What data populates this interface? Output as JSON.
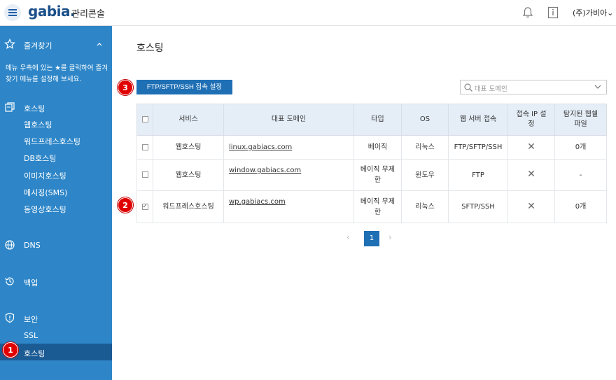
{
  "header": {
    "logo": "gabia.",
    "console_title": "관리콘솔",
    "user_name": "(주)가비아",
    "user_chevron": "⌄",
    "icons": [
      "menu-icon",
      "bell-icon",
      "info-icon",
      "chevron-down-icon"
    ]
  },
  "sidebar": {
    "favorites_label": "즐겨찾기",
    "favorites_note": "메뉴 우측에 있는 ★를 클릭하여 즐겨찾기 메뉴를 설정해 보세요.",
    "hosting_label": "호스팅",
    "hosting_items": [
      "웹호스팅",
      "워드프레스호스팅",
      "DB호스팅",
      "이미지호스팅",
      "메시징(SMS)",
      "동영상호스팅"
    ],
    "dns_label": "DNS",
    "backup_label": "백업",
    "security_label": "보안",
    "security_items": [
      "SSL",
      "호스팅"
    ],
    "icons": [
      "star-icon",
      "chevron-up-icon",
      "hosting-icon",
      "globe-icon",
      "backup-icon",
      "shield-icon"
    ]
  },
  "badges": [
    "1",
    "2",
    "3"
  ],
  "main": {
    "title": "호스팅",
    "ftp_button": "FTP/SFTP/SSH 접속 설정",
    "search_placeholder": "대표 도메인",
    "columns": [
      "서비스",
      "대표 도메인",
      "타입",
      "OS",
      "웹 서버 접속",
      "접속 IP 설정",
      "탐지된 웹쉘 파일"
    ],
    "rows": [
      {
        "service": "웹호스팅",
        "domain": "linux.gabiacs.com",
        "type": "베이직",
        "os": "리눅스",
        "access": "FTP/SFTP/SSH",
        "ip": "✕",
        "webshell": "0개",
        "checked": false
      },
      {
        "service": "웹호스팅",
        "domain": "window.gabiacs.com",
        "type": "베이직 무제한",
        "os": "윈도우",
        "access": "FTP",
        "ip": "✕",
        "webshell": "-",
        "checked": false
      },
      {
        "service": "워드프레스호스팅",
        "domain": "wp.gabiacs.com",
        "type": "베이직 무제한",
        "os": "리눅스",
        "access": "SFTP/SSH",
        "ip": "✕",
        "webshell": "0개",
        "checked": true
      }
    ],
    "pager": {
      "prev": "‹",
      "current": "1",
      "next": "›"
    }
  }
}
